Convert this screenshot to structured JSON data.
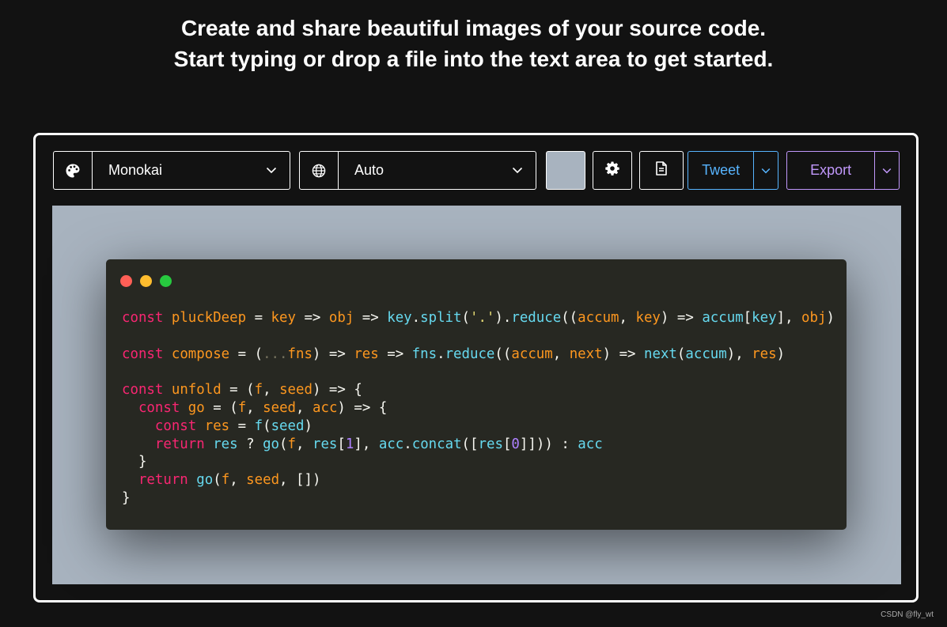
{
  "heading": {
    "line1": "Create and share beautiful images of your source code.",
    "line2": "Start typing or drop a file into the text area to get started."
  },
  "toolbar": {
    "theme": {
      "icon": "palette-icon",
      "value": "Monokai"
    },
    "language": {
      "icon": "globe-icon",
      "value": "Auto"
    },
    "background_color": "#a8b3bf",
    "settings_icon": "gear-icon",
    "copy_icon": "copy-file-icon",
    "tweet_label": "Tweet",
    "export_label": "Export"
  },
  "colors": {
    "page_bg": "#121212",
    "canvas_bg": "#a8b3bf",
    "window_bg": "#272822",
    "tweet": "#57b4ff",
    "export": "#c198fb",
    "dot_red": "#ff5f56",
    "dot_yellow": "#ffbd2e",
    "dot_green": "#27c93f"
  },
  "code": {
    "lines": [
      "const pluckDeep = key => obj => key.split('.').reduce((accum, key) => accum[key], obj)",
      "",
      "const compose = (...fns) => res => fns.reduce((accum, next) => next(accum), res)",
      "",
      "const unfold = (f, seed) => {",
      "  const go = (f, seed, acc) => {",
      "    const res = f(seed)",
      "    return res ? go(f, res[1], acc.concat([res[0]])) : acc",
      "  }",
      "  return go(f, seed, [])",
      "}"
    ]
  },
  "footer": {
    "watermark": "CSDN @fly_wt"
  }
}
